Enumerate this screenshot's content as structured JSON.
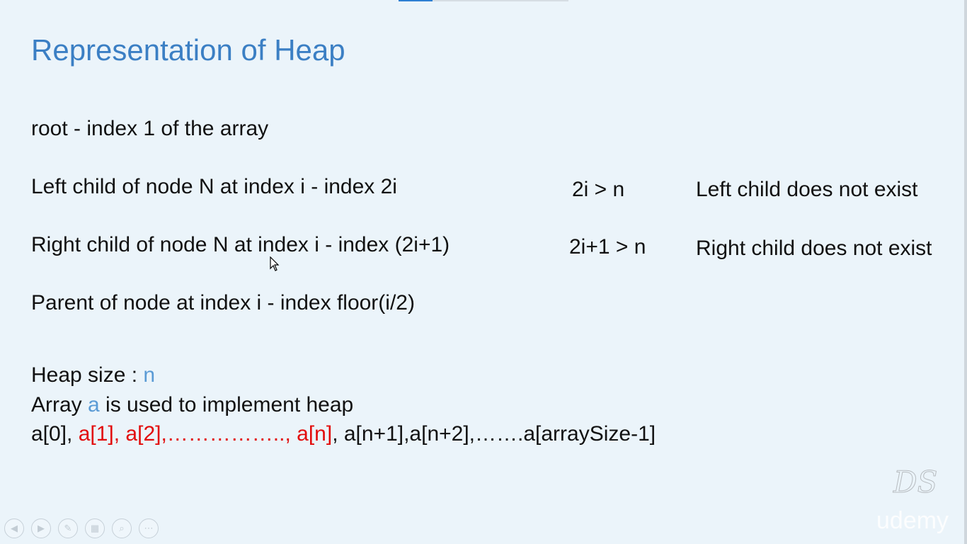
{
  "slide": {
    "title": "Representation of Heap",
    "root_line": "root -  index 1 of the array",
    "left_child_line": "Left child of node N at index i - index 2i",
    "left_condition": "2i > n",
    "left_result": "Left child does not exist",
    "right_child_line": "Right child of node N at index i - index (2i+1)",
    "right_condition": "2i+1 > n",
    "right_result": "Right child does not exist",
    "parent_line": "Parent of node at index i - index floor(i/2)",
    "heap_size_label": "Heap size : ",
    "heap_size_var": "n",
    "array_prefix": "Array ",
    "array_var": "a",
    "array_suffix": " is used to implement heap",
    "array_seq": {
      "part1": "a[0], ",
      "part2_red": "a[1], a[2],…………….., a[n]",
      "part3": ", a[n+1],a[n+2],…….a[arraySize-1]"
    },
    "colors": {
      "title": "#3b7fc4",
      "variable": "#5b9bd5",
      "highlight": "#e20b0b",
      "background": "#ebf4fa"
    }
  },
  "watermark": {
    "ds_logo": "DS",
    "udemy_logo": "udemy"
  },
  "nav_controls": {
    "icons": [
      "previous-icon",
      "next-icon",
      "pen-icon",
      "slides-icon",
      "zoom-icon",
      "more-icon"
    ]
  }
}
